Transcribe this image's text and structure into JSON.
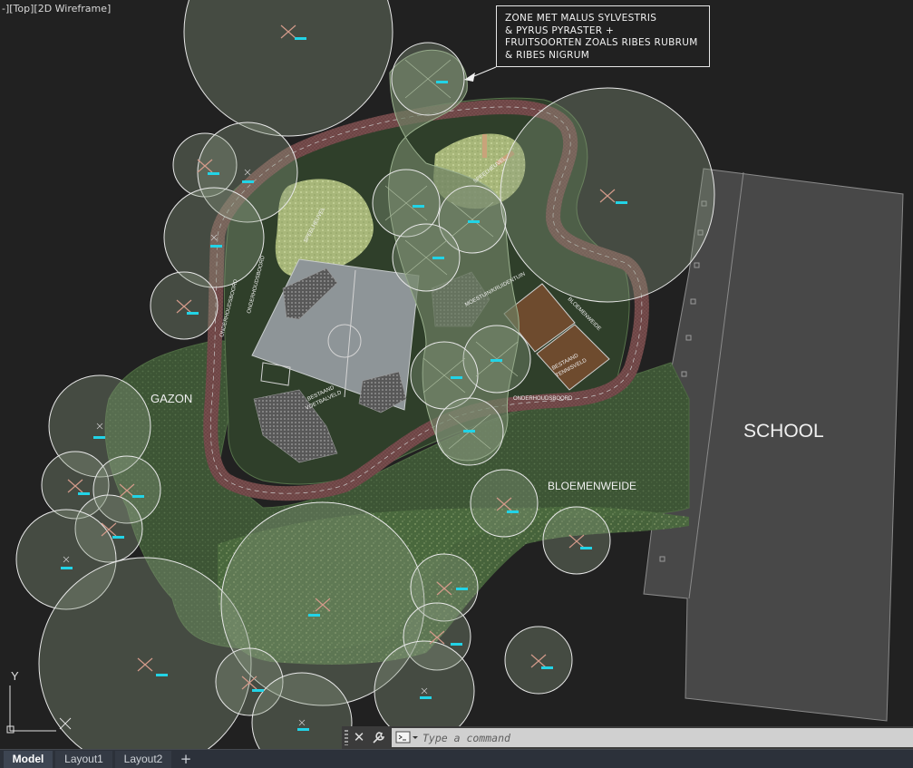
{
  "viewport": {
    "label": "-][Top][2D Wireframe]",
    "ucs": {
      "x": "X",
      "y": "Y"
    }
  },
  "callout": {
    "lines": [
      "ZONE MET MALUS SYLVESTRIS",
      "& PYRUS PYRASTER +",
      "FRUITSOORTEN ZOALS RIBES RUBRUM",
      "& RIBES NIGRUM"
    ]
  },
  "labels": {
    "gazon": "GAZON",
    "school": "SCHOOL",
    "bloemenweide": "BLOEMENWEIDE",
    "speelheuvel_1": "SPEELHEUVEL",
    "speelheuvel_2": "SPEELHEUVEL",
    "moestuin": "MOESTUIN/KRUIDENTUIN",
    "bloemenweide_small": "BLOEMENWEIDE",
    "onderhoudsboord_1": "ONDERHOUDSBOORD",
    "onderhoudsboord_2": "ONDERHOUDSBOORD",
    "onderhoudsboord_3": "ONDERHOUDSBOORD",
    "bestaand_voetbalveld_1": "BESTAAND",
    "bestaand_voetbalveld_2": "VOETBALVELD",
    "bestaand_tennisveld_1": "BESTAAND",
    "bestaand_tennisveld_2": "TENNISVELD"
  },
  "commandline": {
    "placeholder": "Type a command"
  },
  "tabs": [
    {
      "label": "Model",
      "active": true
    },
    {
      "label": "Layout1",
      "active": false
    },
    {
      "label": "Layout2",
      "active": false
    }
  ],
  "colors": {
    "background": "#212121",
    "grass": "#3e5436",
    "tree_fill": "#7e8f78",
    "path": "#6a4848",
    "cyan_tag": "#22d3e6",
    "school": "#484848"
  }
}
